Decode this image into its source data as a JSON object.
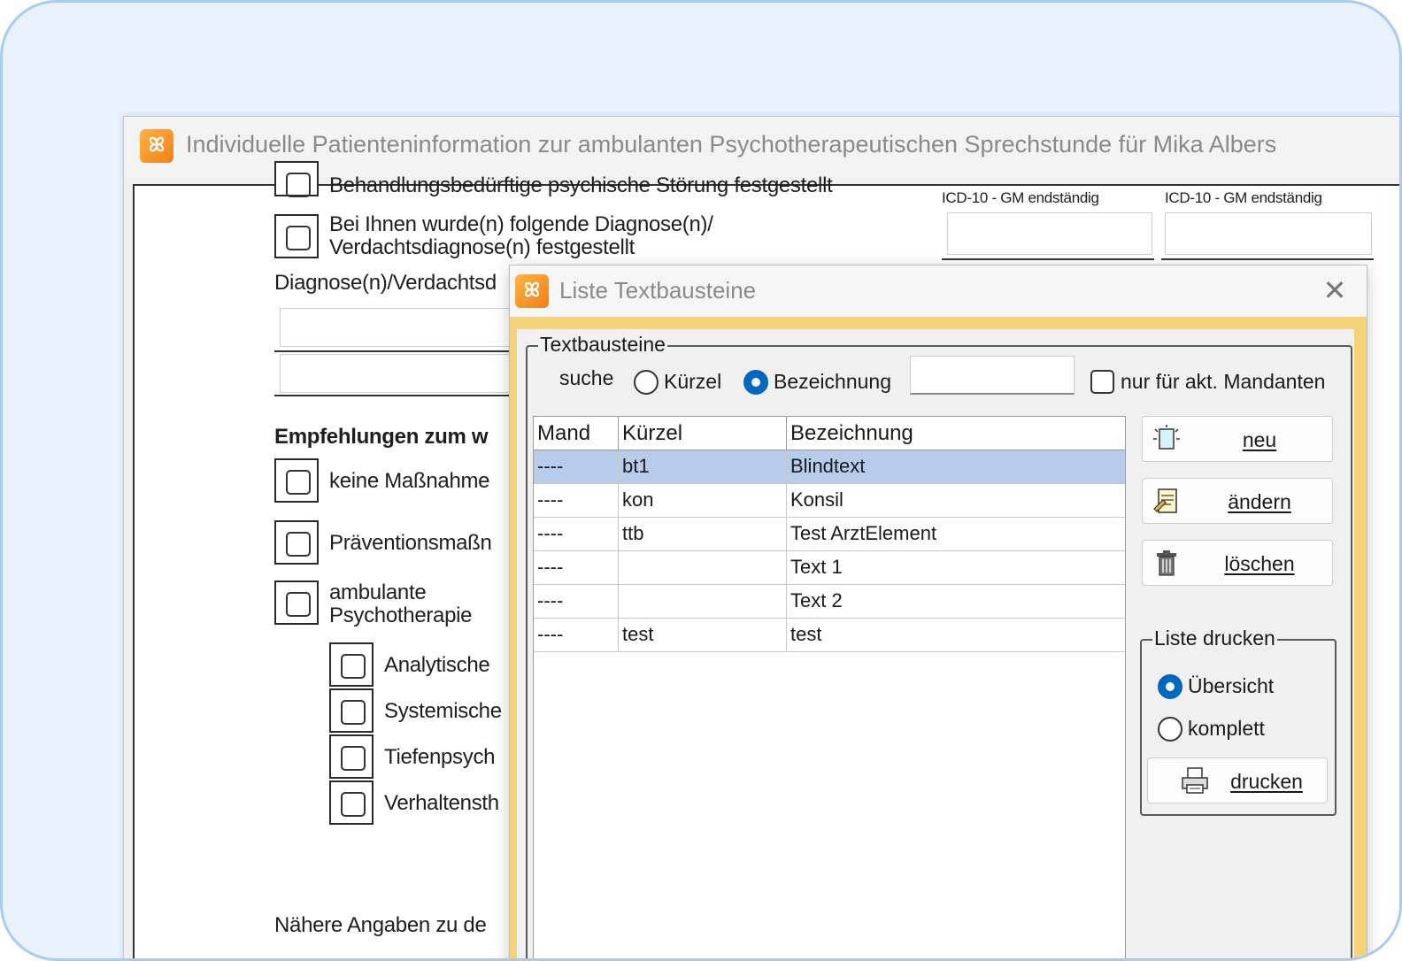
{
  "main_window": {
    "title": "Individuelle Patienteninformation zur ambulanten Psychotherapeutischen Sprechstunde  für Mika Albers"
  },
  "form": {
    "top_cut_text": "Behandlungsbedürftige psychische Störung festgestellt",
    "diagnosis_line1": "Bei Ihnen wurde(n) folgende Diagnose(n)/",
    "diagnosis_line2": "Verdachtsdiagnose(n) festgestellt",
    "icd_label_1": "ICD-10 - GM endständig",
    "icd_label_2": "ICD-10 - GM endständig",
    "diagnosis_label": "Diagnose(n)/Verdachtsd",
    "recommend_heading": "Empfehlungen zum w",
    "option_keine": "keine Maßnahme",
    "option_praevention": "Präventionsmaßn",
    "option_ambulant_1": "ambulante",
    "option_ambulant_2": "Psychotherapie",
    "sub_analytisch": "Analytische",
    "sub_systemisch": "Systemische",
    "sub_tiefenpsych": "Tiefenpsych",
    "sub_verhalten": "Verhaltensth",
    "details_label": "Nähere Angaben zu de"
  },
  "dialog": {
    "title": "Liste Textbausteine",
    "group_label": "Textbausteine",
    "search_label": "suche",
    "radio_kuerzel": "Kürzel",
    "radio_bezeichnung": "Bezeichnung",
    "search_value": "",
    "only_current_label": "nur für akt. Mandanten",
    "columns": {
      "mand": "Mand",
      "kuerzel": "Kürzel",
      "bezeichnung": "Bezeichnung"
    },
    "rows": [
      {
        "mand": "----",
        "kuerzel": "bt1",
        "bezeichnung": "Blindtext"
      },
      {
        "mand": "----",
        "kuerzel": "kon",
        "bezeichnung": "Konsil"
      },
      {
        "mand": "----",
        "kuerzel": "ttb",
        "bezeichnung": "Test ArztElement"
      },
      {
        "mand": "----",
        "kuerzel": "",
        "bezeichnung": "Text 1"
      },
      {
        "mand": "----",
        "kuerzel": "",
        "bezeichnung": "Text 2"
      },
      {
        "mand": "----",
        "kuerzel": "test",
        "bezeichnung": "test"
      }
    ],
    "buttons": {
      "neu": "neu",
      "aendern": "ändern",
      "loeschen": "löschen",
      "drucken": "drucken"
    },
    "print_group_label": "Liste drucken",
    "radio_uebersicht": "Übersicht",
    "radio_komplett": "komplett"
  },
  "colors": {
    "accent_blue": "#0067c0",
    "selection": "#b7cbea",
    "dialog_frame": "#f3d27a",
    "app_icon": "#f37f14",
    "outer_border": "#a8ccf0"
  },
  "icons": [
    "app-logo-icon",
    "close-icon",
    "new-document-icon",
    "edit-document-icon",
    "trash-icon",
    "printer-icon"
  ]
}
